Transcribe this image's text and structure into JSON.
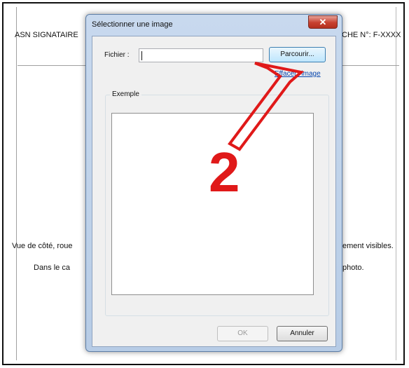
{
  "document": {
    "header_left": "ASN SIGNATAIRE",
    "header_right": "CHE N°:  F-XXXX",
    "line1_left": "Vue de côté, roue",
    "line1_right": "ement visibles.",
    "line2_left": "Dans le ca",
    "line2_right": "photo."
  },
  "dialog": {
    "title": "Sélectionner une image",
    "close_glyph": "✕",
    "file_label": "Fichier :",
    "file_value": "",
    "browse_label": "Parcourir...",
    "clear_link": "Effacer l'image",
    "group_label": "Exemple",
    "ok_label": "OK",
    "cancel_label": "Annuler"
  },
  "annotation": {
    "number": "2",
    "color": "#e01919"
  }
}
